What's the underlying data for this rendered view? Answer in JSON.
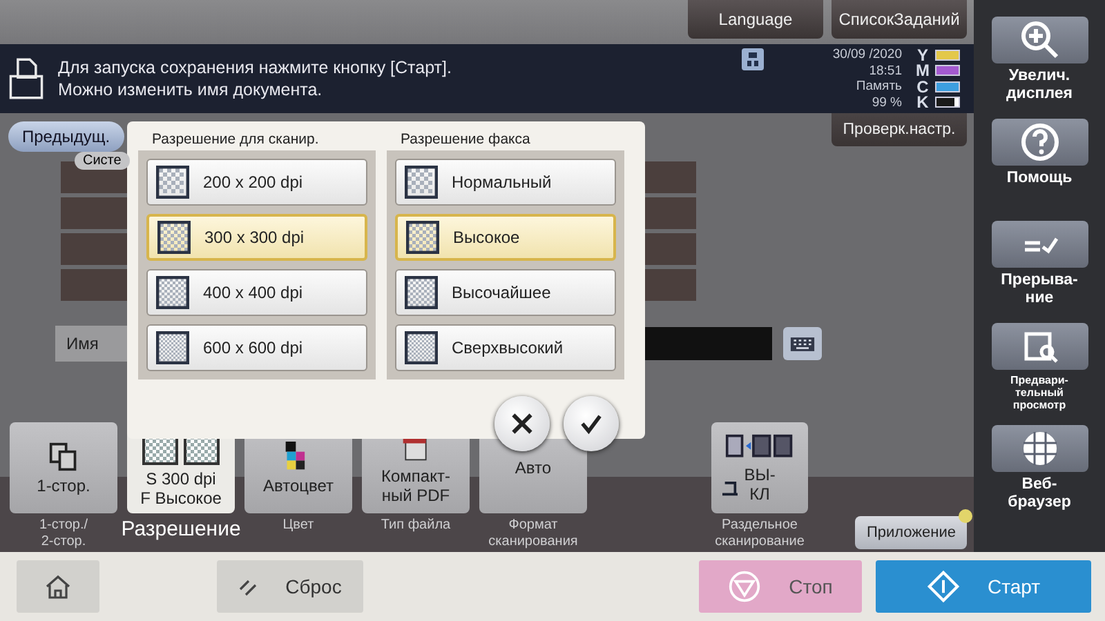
{
  "top_buttons": [
    {
      "label": "Language"
    },
    {
      "label": "СписокЗаданий"
    }
  ],
  "message": {
    "lines": [
      "Для запуска сохранения нажмите кнопку [Старт].",
      "Можно изменить имя документа."
    ]
  },
  "status": {
    "date": "30/09 /2020",
    "time": "18:51",
    "memory_label": "Память",
    "memory": "99 %"
  },
  "toners": [
    {
      "letter": "Y",
      "color": "#e3c84a",
      "level": 1
    },
    {
      "letter": "M",
      "color": "#a45ad0",
      "level": 1
    },
    {
      "letter": "C",
      "color": "#3d9ee0",
      "level": 1
    },
    {
      "letter": "K",
      "color": "#1a1a1a",
      "level": 0.8
    }
  ],
  "prev_button": "Предыдущ.",
  "check_button": "Проверк.настр.",
  "background_form": {
    "tab": "Систе",
    "name_label": "Имя"
  },
  "popup": {
    "groups": [
      {
        "title": "Разрешение для сканир.",
        "options": [
          {
            "label": "200 x 200 dpi",
            "selected": false
          },
          {
            "label": "300 x 300 dpi",
            "selected": true
          },
          {
            "label": "400 x 400 dpi",
            "selected": false
          },
          {
            "label": "600 x 600 dpi",
            "selected": false
          }
        ]
      },
      {
        "title": "Разрешение факса",
        "options": [
          {
            "label": "Нормальный",
            "selected": false
          },
          {
            "label": "Высокое",
            "selected": true
          },
          {
            "label": "Высочайшее",
            "selected": false
          },
          {
            "label": "Сверхвысокий",
            "selected": false
          }
        ]
      }
    ]
  },
  "function_keys": [
    {
      "kind": "duplex",
      "value_lines": [
        "1-стор."
      ],
      "caption_lines": [
        "1-стор./",
        "2-стор."
      ],
      "selected": false
    },
    {
      "kind": "resolution",
      "value_lines": [
        "S 300 dpi",
        "F Высокое"
      ],
      "caption_lines": [
        "Разрешение"
      ],
      "selected": true
    },
    {
      "kind": "color",
      "value_lines": [
        "Автоцвет"
      ],
      "caption_lines": [
        "Цвет"
      ],
      "selected": false
    },
    {
      "kind": "pdf",
      "value_lines": [
        "Компакт-",
        "ный PDF"
      ],
      "caption_lines": [
        "Тип файла"
      ],
      "selected": false
    },
    {
      "kind": "plain",
      "value_lines": [
        "Авто"
      ],
      "caption_lines": [
        "Формат",
        "сканирования"
      ],
      "selected": false
    },
    {
      "kind": "separate",
      "value_lines": [
        "ВЫ-",
        "КЛ"
      ],
      "caption_lines": [
        "Раздельное",
        "сканирование"
      ],
      "selected": false
    }
  ],
  "app_button": "Приложение",
  "side_buttons": [
    {
      "kind": "zoom",
      "lines": [
        "Увелич.",
        "дисплея"
      ]
    },
    {
      "kind": "help",
      "lines": [
        "Помощь"
      ]
    },
    {
      "kind": "interrupt",
      "lines": [
        "Прерыва-",
        "ние"
      ]
    },
    {
      "kind": "preview",
      "lines": [
        "Предвари-",
        "тельный",
        "просмотр"
      ]
    },
    {
      "kind": "web",
      "lines": [
        "Веб-",
        "браузер"
      ]
    }
  ],
  "bottom": {
    "reset": "Сброс",
    "stop": "Стоп",
    "start": "Старт"
  }
}
